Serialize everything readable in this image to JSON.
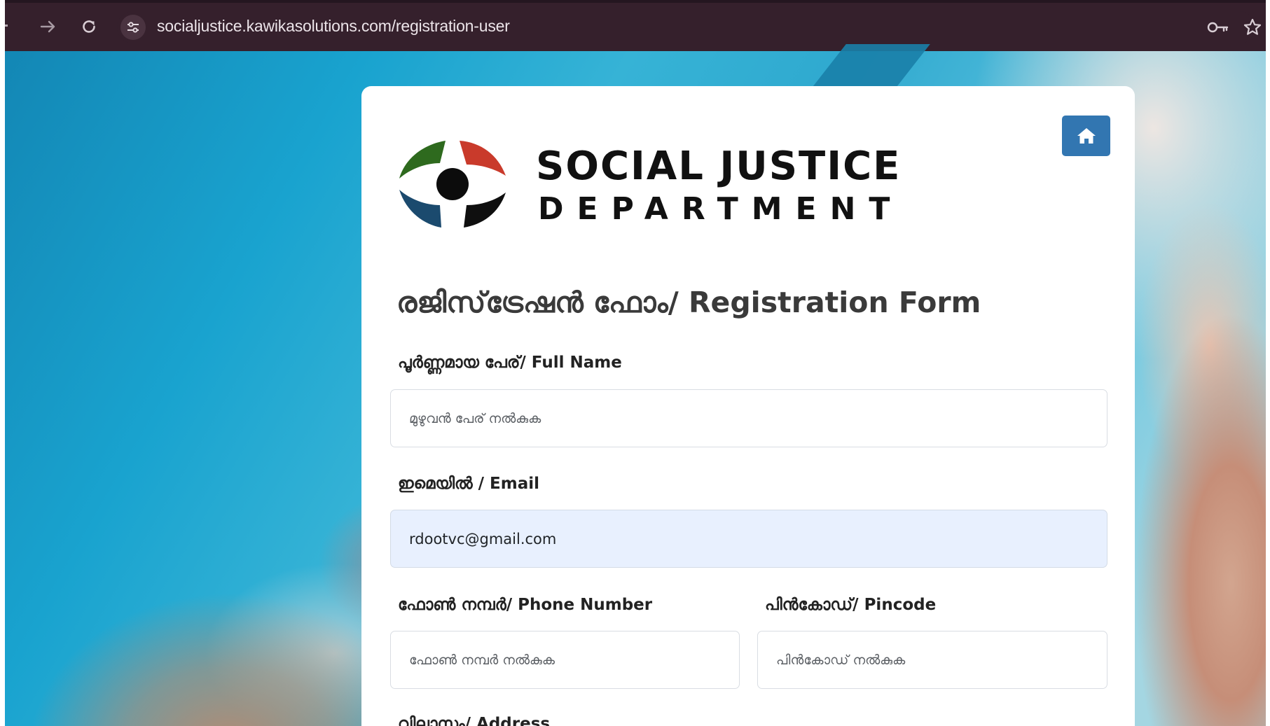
{
  "browser": {
    "url": "socialjustice.kawikasolutions.com/registration-user",
    "icons": [
      "back-icon",
      "forward-icon",
      "reload-icon",
      "site-info-icon",
      "password-key-icon",
      "bookmark-star-icon"
    ]
  },
  "header": {
    "logo_line1": "SOCIAL JUSTICE",
    "logo_line2": "DEPARTMENT",
    "home_icon": "home-icon",
    "home_color": "#3276b1"
  },
  "form": {
    "title": "രജിസ്‌ട്രേഷൻ ഫോം/ Registration Form",
    "full_name": {
      "label": "പൂർണ്ണമായ പേര്/ Full Name",
      "placeholder": "മുഴുവൻ പേര് നൽകുക",
      "value": ""
    },
    "email": {
      "label": "ഇമെയിൽ / Email",
      "value": "rdootvc@gmail.com"
    },
    "phone": {
      "label": "ഫോൺ നമ്പർ/ Phone Number",
      "placeholder": "ഫോൺ നമ്പർ നൽകുക"
    },
    "pincode": {
      "label": "പിൻകോഡ്/ Pincode",
      "placeholder": "പിൻകോഡ് നൽകുക"
    },
    "address": {
      "label": "വിലാസം/ Address"
    }
  }
}
